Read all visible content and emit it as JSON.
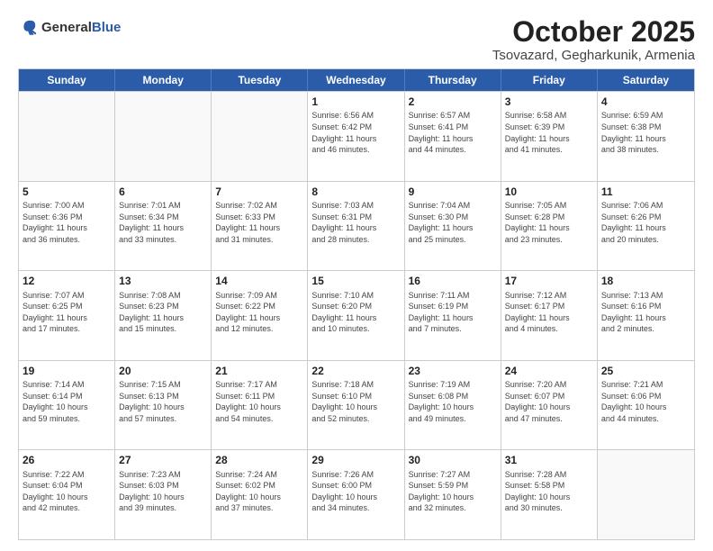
{
  "logo": {
    "general": "General",
    "blue": "Blue"
  },
  "title": "October 2025",
  "location": "Tsovazard, Gegharkunik, Armenia",
  "days": [
    "Sunday",
    "Monday",
    "Tuesday",
    "Wednesday",
    "Thursday",
    "Friday",
    "Saturday"
  ],
  "rows": [
    [
      {
        "day": "",
        "info": ""
      },
      {
        "day": "",
        "info": ""
      },
      {
        "day": "",
        "info": ""
      },
      {
        "day": "1",
        "info": "Sunrise: 6:56 AM\nSunset: 6:42 PM\nDaylight: 11 hours\nand 46 minutes."
      },
      {
        "day": "2",
        "info": "Sunrise: 6:57 AM\nSunset: 6:41 PM\nDaylight: 11 hours\nand 44 minutes."
      },
      {
        "day": "3",
        "info": "Sunrise: 6:58 AM\nSunset: 6:39 PM\nDaylight: 11 hours\nand 41 minutes."
      },
      {
        "day": "4",
        "info": "Sunrise: 6:59 AM\nSunset: 6:38 PM\nDaylight: 11 hours\nand 38 minutes."
      }
    ],
    [
      {
        "day": "5",
        "info": "Sunrise: 7:00 AM\nSunset: 6:36 PM\nDaylight: 11 hours\nand 36 minutes."
      },
      {
        "day": "6",
        "info": "Sunrise: 7:01 AM\nSunset: 6:34 PM\nDaylight: 11 hours\nand 33 minutes."
      },
      {
        "day": "7",
        "info": "Sunrise: 7:02 AM\nSunset: 6:33 PM\nDaylight: 11 hours\nand 31 minutes."
      },
      {
        "day": "8",
        "info": "Sunrise: 7:03 AM\nSunset: 6:31 PM\nDaylight: 11 hours\nand 28 minutes."
      },
      {
        "day": "9",
        "info": "Sunrise: 7:04 AM\nSunset: 6:30 PM\nDaylight: 11 hours\nand 25 minutes."
      },
      {
        "day": "10",
        "info": "Sunrise: 7:05 AM\nSunset: 6:28 PM\nDaylight: 11 hours\nand 23 minutes."
      },
      {
        "day": "11",
        "info": "Sunrise: 7:06 AM\nSunset: 6:26 PM\nDaylight: 11 hours\nand 20 minutes."
      }
    ],
    [
      {
        "day": "12",
        "info": "Sunrise: 7:07 AM\nSunset: 6:25 PM\nDaylight: 11 hours\nand 17 minutes."
      },
      {
        "day": "13",
        "info": "Sunrise: 7:08 AM\nSunset: 6:23 PM\nDaylight: 11 hours\nand 15 minutes."
      },
      {
        "day": "14",
        "info": "Sunrise: 7:09 AM\nSunset: 6:22 PM\nDaylight: 11 hours\nand 12 minutes."
      },
      {
        "day": "15",
        "info": "Sunrise: 7:10 AM\nSunset: 6:20 PM\nDaylight: 11 hours\nand 10 minutes."
      },
      {
        "day": "16",
        "info": "Sunrise: 7:11 AM\nSunset: 6:19 PM\nDaylight: 11 hours\nand 7 minutes."
      },
      {
        "day": "17",
        "info": "Sunrise: 7:12 AM\nSunset: 6:17 PM\nDaylight: 11 hours\nand 4 minutes."
      },
      {
        "day": "18",
        "info": "Sunrise: 7:13 AM\nSunset: 6:16 PM\nDaylight: 11 hours\nand 2 minutes."
      }
    ],
    [
      {
        "day": "19",
        "info": "Sunrise: 7:14 AM\nSunset: 6:14 PM\nDaylight: 10 hours\nand 59 minutes."
      },
      {
        "day": "20",
        "info": "Sunrise: 7:15 AM\nSunset: 6:13 PM\nDaylight: 10 hours\nand 57 minutes."
      },
      {
        "day": "21",
        "info": "Sunrise: 7:17 AM\nSunset: 6:11 PM\nDaylight: 10 hours\nand 54 minutes."
      },
      {
        "day": "22",
        "info": "Sunrise: 7:18 AM\nSunset: 6:10 PM\nDaylight: 10 hours\nand 52 minutes."
      },
      {
        "day": "23",
        "info": "Sunrise: 7:19 AM\nSunset: 6:08 PM\nDaylight: 10 hours\nand 49 minutes."
      },
      {
        "day": "24",
        "info": "Sunrise: 7:20 AM\nSunset: 6:07 PM\nDaylight: 10 hours\nand 47 minutes."
      },
      {
        "day": "25",
        "info": "Sunrise: 7:21 AM\nSunset: 6:06 PM\nDaylight: 10 hours\nand 44 minutes."
      }
    ],
    [
      {
        "day": "26",
        "info": "Sunrise: 7:22 AM\nSunset: 6:04 PM\nDaylight: 10 hours\nand 42 minutes."
      },
      {
        "day": "27",
        "info": "Sunrise: 7:23 AM\nSunset: 6:03 PM\nDaylight: 10 hours\nand 39 minutes."
      },
      {
        "day": "28",
        "info": "Sunrise: 7:24 AM\nSunset: 6:02 PM\nDaylight: 10 hours\nand 37 minutes."
      },
      {
        "day": "29",
        "info": "Sunrise: 7:26 AM\nSunset: 6:00 PM\nDaylight: 10 hours\nand 34 minutes."
      },
      {
        "day": "30",
        "info": "Sunrise: 7:27 AM\nSunset: 5:59 PM\nDaylight: 10 hours\nand 32 minutes."
      },
      {
        "day": "31",
        "info": "Sunrise: 7:28 AM\nSunset: 5:58 PM\nDaylight: 10 hours\nand 30 minutes."
      },
      {
        "day": "",
        "info": ""
      }
    ]
  ]
}
